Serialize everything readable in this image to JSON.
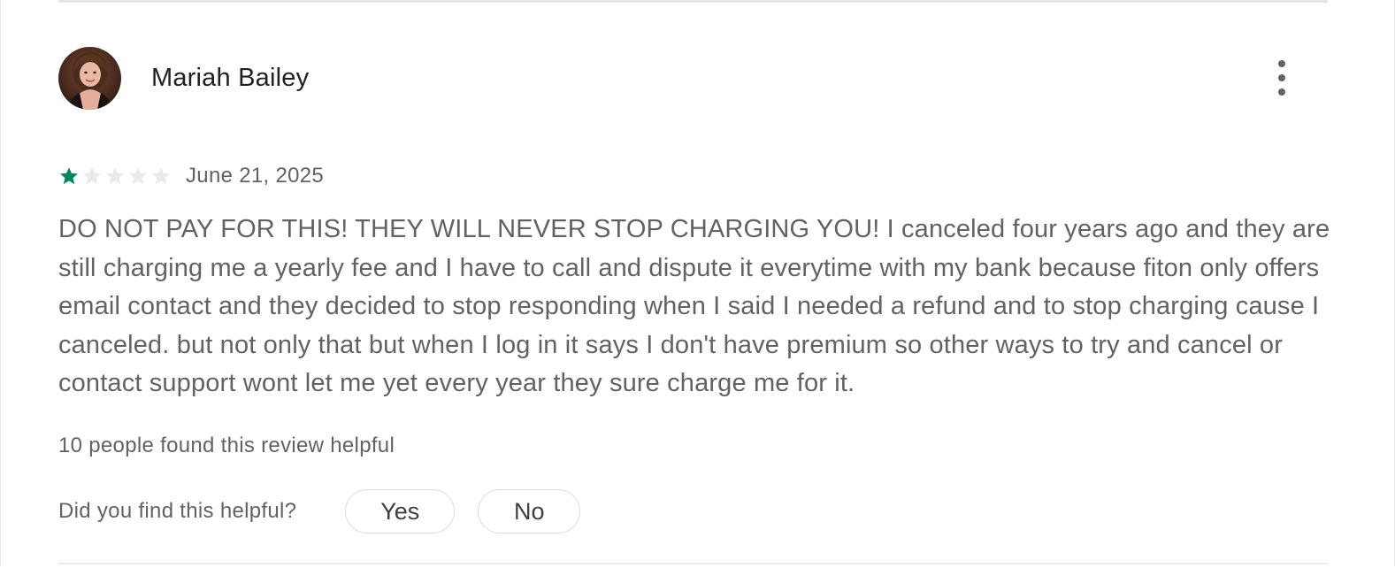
{
  "review": {
    "reviewer_name": "Mariah Bailey",
    "avatar_icon": "avatar-photo",
    "more_options_icon": "more-vert-icon",
    "rating": 1,
    "max_rating": 5,
    "star_filled_color": "#01875f",
    "star_empty_color": "#e8eaed",
    "date": "June 21, 2025",
    "text": "DO NOT PAY FOR THIS! THEY WILL NEVER STOP CHARGING YOU! I canceled four years ago and they are still charging me a yearly fee and I have to call and dispute it everytime with my bank because fiton only offers email contact and they decided to stop responding when I said I needed a refund and to stop charging cause I canceled. but not only that but when I log in it says I don't have premium so other ways to try and cancel or contact support wont let me yet every year they sure charge me for it.",
    "helpful_count_text": "10 people found this review helpful",
    "helpful_question": "Did you find this helpful?",
    "yes_label": "Yes",
    "no_label": "No"
  }
}
